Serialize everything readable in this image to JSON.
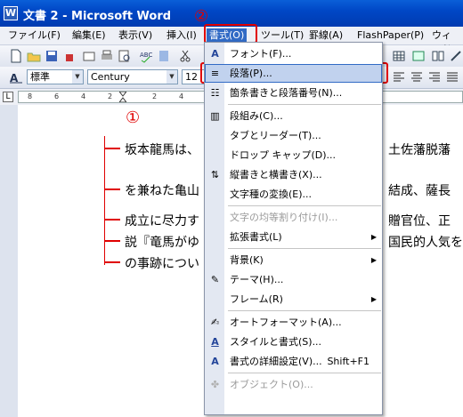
{
  "window": {
    "title": "文書 2 - Microsoft Word"
  },
  "menubar": {
    "items": [
      "ファイル(F)",
      "編集(E)",
      "表示(V)",
      "挿入(I)",
      "書式(O)",
      "ツール(T)",
      "罫線(A)",
      "FlashPaper(P)",
      "ウィンドウ"
    ]
  },
  "formatbar": {
    "style": "標準",
    "font": "Century",
    "size": "12"
  },
  "ruler": {
    "ticks": [
      "8",
      "6",
      "4",
      "2",
      "2",
      "4",
      "6",
      "8",
      "10"
    ]
  },
  "document": {
    "lines": [
      "坂本龍馬は、",
      "を兼ねた亀山",
      "成立に尽力す",
      "説『竜馬がゆ",
      "の事跡につい"
    ],
    "right_fragments": [
      "土佐藩脱藩",
      "結成、薩長",
      "贈官位、正",
      "国民的人気を"
    ]
  },
  "annotations": {
    "marker1": "①",
    "marker2": "②"
  },
  "format_menu": {
    "items": [
      {
        "label": "フォント(F)...",
        "icon": "font-icon",
        "glyph": "A"
      },
      {
        "label": "段落(P)...",
        "icon": "paragraph-icon",
        "glyph": "≡",
        "highlighted": true
      },
      {
        "label": "箇条書きと段落番号(N)...",
        "icon": "bullets-icon",
        "glyph": "☷"
      },
      {
        "label": "段組み(C)...",
        "icon": "columns-icon",
        "glyph": "▥"
      },
      {
        "label": "タブとリーダー(T)...",
        "icon": "",
        "glyph": ""
      },
      {
        "label": "ドロップ キャップ(D)...",
        "icon": "",
        "glyph": ""
      },
      {
        "label": "縦書きと横書き(X)...",
        "icon": "text-direction-icon",
        "glyph": "⇅"
      },
      {
        "label": "文字種の変換(E)...",
        "icon": "",
        "glyph": ""
      },
      {
        "label": "文字の均等割り付け(I)...",
        "icon": "",
        "glyph": "",
        "disabled": true
      },
      {
        "label": "拡張書式(L)",
        "icon": "",
        "glyph": "",
        "submenu": true
      },
      {
        "label": "背景(K)",
        "icon": "",
        "glyph": "",
        "submenu": true
      },
      {
        "label": "テーマ(H)...",
        "icon": "theme-icon",
        "glyph": "✎"
      },
      {
        "label": "フレーム(R)",
        "icon": "",
        "glyph": "",
        "submenu": true
      },
      {
        "label": "オートフォーマット(A)...",
        "icon": "autoformat-icon",
        "glyph": "✍"
      },
      {
        "label": "スタイルと書式(S)...",
        "icon": "styles-icon",
        "glyph": "A"
      },
      {
        "label": "書式の詳細設定(V)...",
        "icon": "reveal-formatting-icon",
        "glyph": "A",
        "shortcut": "Shift+F1"
      },
      {
        "label": "オブジェクト(O)...",
        "icon": "object-icon",
        "glyph": "✤",
        "disabled": true
      }
    ]
  },
  "colors": {
    "accent": "#316ac5",
    "annotation": "#e00000",
    "titlebar": "#0047c6"
  }
}
